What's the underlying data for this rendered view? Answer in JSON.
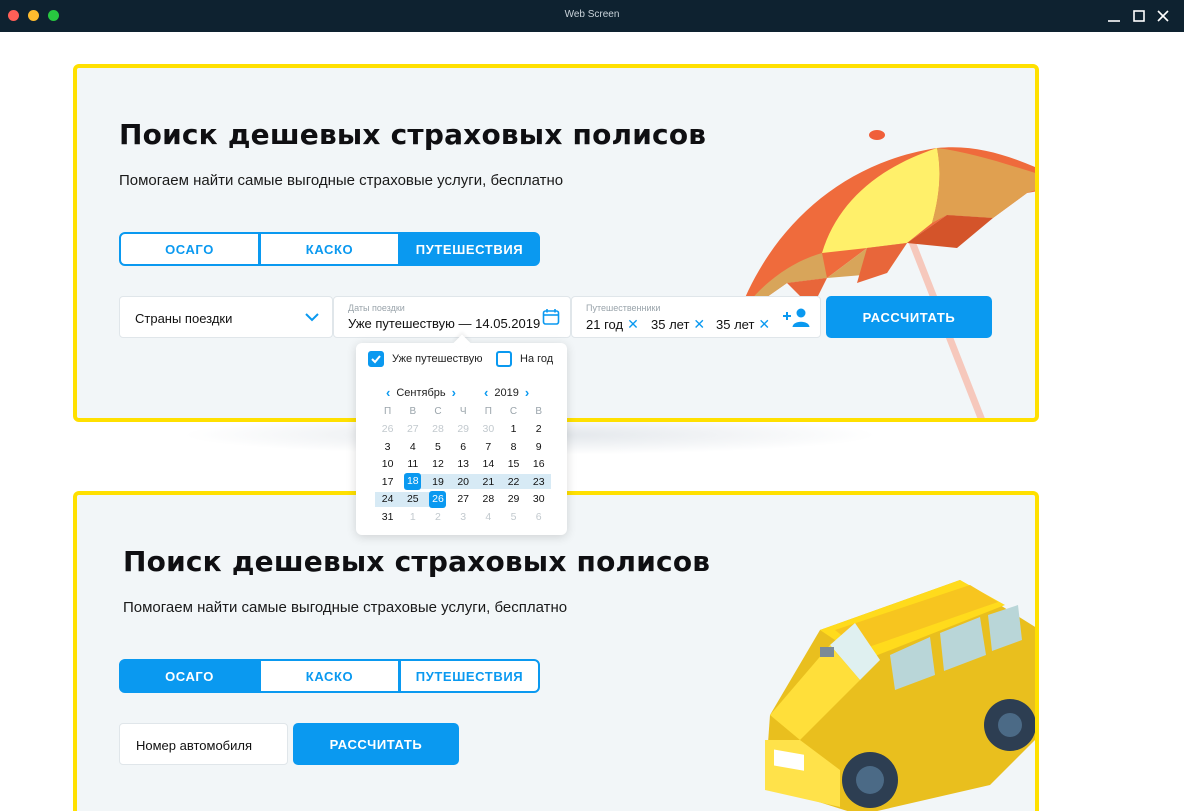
{
  "window": {
    "title": "Web Screen"
  },
  "card1": {
    "heading": "Поиск дешевых страховых полисов",
    "subtitle": "Помогаем найти самые выгодные страховые услуги, бесплатно",
    "tabs": [
      {
        "label": "ОСАГО",
        "active": false
      },
      {
        "label": "КАСКО",
        "active": false
      },
      {
        "label": "ПУТЕШЕСТВИЯ",
        "active": true
      }
    ],
    "countries": {
      "placeholder": "Страны поездки"
    },
    "dates": {
      "label": "Даты поездки",
      "value": "Уже путешествую — 14.05.2019"
    },
    "travelers": {
      "label": "Путешественники",
      "items": [
        "21 год",
        "35 лет",
        "35 лет"
      ]
    },
    "submit_label": "РАССЧИТАТЬ"
  },
  "calendar": {
    "already_travelling_label": "Уже путешествую",
    "already_travelling_checked": true,
    "per_year_label": "На год",
    "per_year_checked": false,
    "month": "Сентябрь",
    "year": "2019",
    "weekdays": [
      "П",
      "В",
      "С",
      "Ч",
      "П",
      "С",
      "В"
    ],
    "weeks": [
      [
        "26",
        "27",
        "28",
        "29",
        "30",
        "1",
        "2"
      ],
      [
        "3",
        "4",
        "5",
        "6",
        "7",
        "8",
        "9"
      ],
      [
        "10",
        "11",
        "12",
        "13",
        "14",
        "15",
        "16"
      ],
      [
        "17",
        "18",
        "19",
        "20",
        "21",
        "22",
        "23"
      ],
      [
        "24",
        "25",
        "26",
        "27",
        "28",
        "29",
        "30"
      ],
      [
        "31",
        "1",
        "2",
        "3",
        "4",
        "5",
        "6"
      ]
    ],
    "range_start": "18",
    "range_end": "26"
  },
  "card2": {
    "heading": "Поиск дешевых страховых полисов",
    "subtitle": "Помогаем найти самые выгодные страховые услуги, бесплатно",
    "tabs": [
      {
        "label": "ОСАГО",
        "active": true
      },
      {
        "label": "КАСКО",
        "active": false
      },
      {
        "label": "ПУТЕШЕСТВИЯ",
        "active": false
      }
    ],
    "car_number": {
      "placeholder": "Номер автомобиля"
    },
    "submit_label": "РАССЧИТАТЬ"
  },
  "colors": {
    "accent": "#0a99f0",
    "border": "#ffe000",
    "card_bg": "#f2f6f8",
    "titlebar": "#0e2230"
  },
  "icons": [
    "calendar-icon",
    "chevron-down-icon",
    "remove-traveler-icon",
    "add-traveler-icon",
    "umbrella-illustration",
    "car-illustration"
  ]
}
